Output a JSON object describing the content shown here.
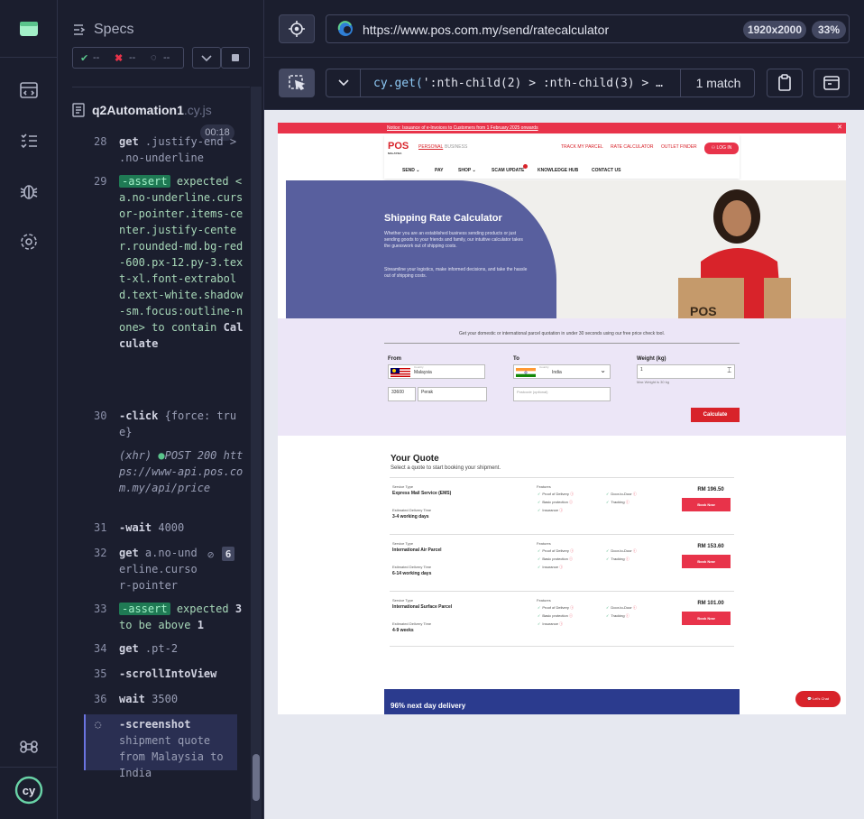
{
  "specs": {
    "title": "Specs",
    "stats": {
      "passed": "--",
      "failed": "--",
      "pending": "--"
    },
    "file_name": "q2Automation1",
    "file_ext": ".cy.js",
    "timer": "00:18"
  },
  "log": [
    {
      "num": "28",
      "parts": [
        "get",
        ".justify-end > .no-underline"
      ]
    },
    {
      "num": "29",
      "parts": [
        "-assert",
        "expected <a.no-underline.cursor-pointer.items-center.justify-center.rounded-md.bg-red-600.px-12.py-3.text-xl.font-extrabold.text-white.shadow-sm.focus:outline-none>",
        "to contain",
        "Calculate"
      ]
    },
    {
      "num": "30",
      "parts": [
        "-click",
        "{force: true}"
      ]
    },
    {
      "num": "",
      "parts": [
        "(xhr)",
        "POST 200",
        "https://www-api.pos.com.my/api/price"
      ]
    },
    {
      "num": "31",
      "parts": [
        "-wait",
        "4000"
      ]
    },
    {
      "num": "32",
      "parts": [
        "get",
        "a.no-underline.cursor-pointer",
        "6"
      ]
    },
    {
      "num": "33",
      "parts": [
        "-assert",
        "expected",
        "3",
        "to be above",
        "1"
      ]
    },
    {
      "num": "34",
      "parts": [
        "get",
        ".pt-2"
      ]
    },
    {
      "num": "35",
      "parts": [
        "-scrollIntoView"
      ]
    },
    {
      "num": "36",
      "parts": [
        "wait",
        "3500"
      ]
    },
    {
      "num": "",
      "parts": [
        "-screenshot",
        "shipment quote from Malaysia to India"
      ]
    }
  ],
  "browser": {
    "url": "https://www.pos.com.my/send/ratecalculator",
    "viewport": "1920x2000",
    "zoom": "33%"
  },
  "selector": {
    "fn": "cy.get(",
    "query": "':nth-child(2) > :nth-child(3) > …",
    "match": "1 match"
  },
  "site": {
    "notice": "Notice: Issuance of e-Invoices to Customers from 1 February 2025 onwards",
    "logo": "POS",
    "logo_sub": "MALAYSIA",
    "personal": "PERSONAL",
    "business": "BUSINESS",
    "links": [
      "TRACK MY PARCEL",
      "RATE CALCULATOR",
      "OUTLET FINDER"
    ],
    "login": "LOG IN",
    "nav": [
      "SEND",
      "PAY",
      "SHOP",
      "SCAM UPDATE",
      "KNOWLEDGE HUB",
      "CONTACT US"
    ],
    "hero_title": "Shipping Rate Calculator",
    "hero_p1": "Whether you are an established business sending products or just sending goods to your friends and family, our intuitive calculator takes the guesswork out of shipping costs.",
    "hero_p2": "Streamline your logistics, make informed decisions, and take the hassle out of shipping costs.",
    "calc_intro": "Get your domestic or international parcel quotation in under 30 seconds using our free price check tool.",
    "from_label": "From",
    "from_country_label": "Country",
    "from_country": "Malaysia",
    "from_postcode": "33600",
    "from_state": "Perak",
    "to_label": "To",
    "to_country_label": "Country",
    "to_country": "India",
    "to_postcode_placeholder": "Postcode (optional)",
    "weight_label": "Weight (kg)",
    "weight_value": "1",
    "weight_hint": "Max Weight is 30 kg",
    "calculate": "Calculate",
    "quote_title": "Your Quote",
    "quote_sub": "Select a quote to start booking your shipment.",
    "service_type_label": "Service Type",
    "edt_label": "Estimated Delivery Time",
    "features_label": "Features",
    "book_now": "Book Now",
    "quotes": [
      {
        "name": "Express Mail Service (EMS)",
        "time": "3-4 working days",
        "price": "RM 196.50",
        "features": [
          "Proof of Delivery",
          "Basic protection",
          "Insurance",
          "Door-to-Door",
          "Tracking"
        ]
      },
      {
        "name": "International Air Parcel",
        "time": "6-14 working days",
        "price": "RM 153.60",
        "features": [
          "Proof of Delivery",
          "Basic protection",
          "Insurance",
          "Door-to-Door",
          "Tracking"
        ]
      },
      {
        "name": "International Surface Parcel",
        "time": "4-9 weeks",
        "price": "RM 101.00",
        "features": [
          "Proof of Delivery",
          "Basic protection",
          "Insurance",
          "Door-to-Door",
          "Tracking"
        ]
      }
    ],
    "promo": "96% next day delivery",
    "chat": "Let's Chat"
  }
}
